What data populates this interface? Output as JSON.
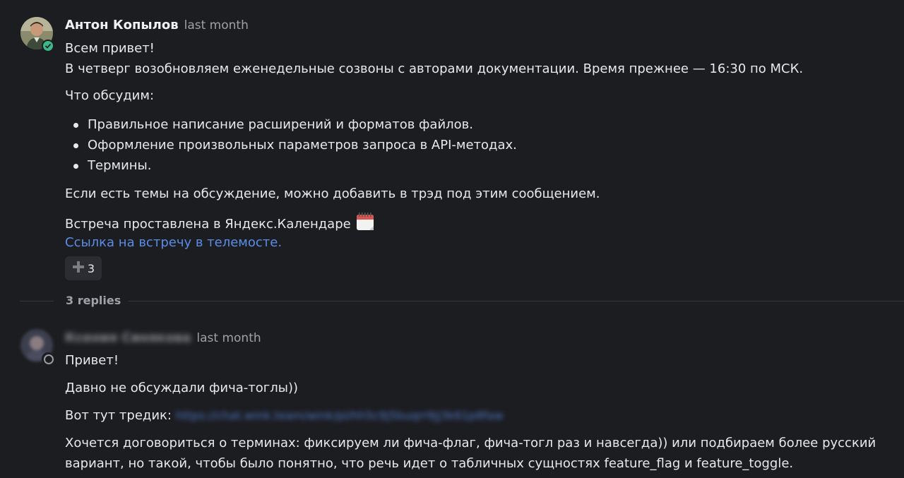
{
  "message_main": {
    "author": "Антон Копылов",
    "time": "last month",
    "greeting": "Всем привет!",
    "intro": "В четверг возобновляем еженедельные созвоны с авторами документации. Время прежнее — 16:30 по МСК.",
    "topics_heading": "Что обсудим:",
    "topics": [
      "Правильное написание расширений и форматов файлов.",
      "Оформление произвольных параметров запроса в API-методах.",
      "Термины."
    ],
    "suggest": "Если есть темы на обсуждение, можно добавить в трэд под этим сообщением.",
    "calendar_note": "Встреча проставлена в Яндекс.Календаре",
    "meeting_link": "Ссылка на встречу в телемосте.",
    "reaction": {
      "icon": "plus-icon",
      "count": "3"
    },
    "status": "online"
  },
  "thread": {
    "replies_label": "3 replies"
  },
  "message_reply": {
    "author": "Ксения Синякова",
    "time": "last month",
    "greeting": "Привет!",
    "line2": "Давно не обсуждали фича-тоглы))",
    "thread_prefix": "Вот тут тредик:",
    "thread_link": "https://chat.wink.team/wink/pl/hh5c9j5buqrr9jj3k61p8faw",
    "line4a": "Хочется договориться о терминах: фиксируем ли фича-флаг, фича-тогл раз и навсегда)) или подбираем более русский",
    "line4b": "вариант, но такой, чтобы было понятно, что речь идет о табличных сущностях feature_flag и feature_toggle.",
    "status": "offline"
  },
  "colors": {
    "background": "#1c1d21",
    "text": "#e8e9eb",
    "muted": "#a0a1a8",
    "link": "#5b8de8",
    "online": "#3db887"
  }
}
